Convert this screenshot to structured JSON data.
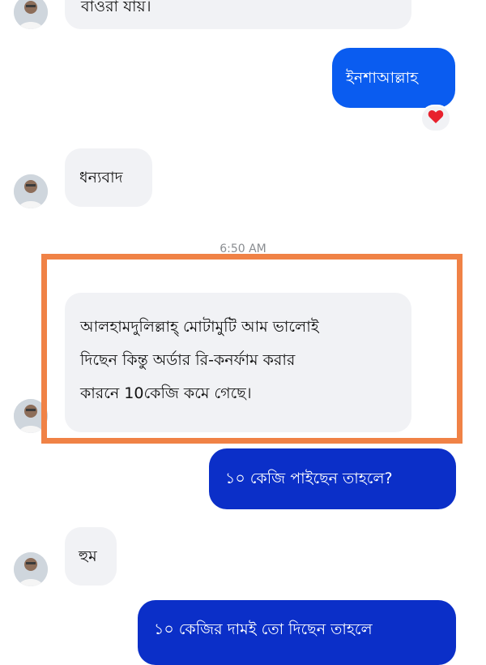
{
  "colors": {
    "outgoing_light": "#0a5cf0",
    "outgoing_dark": "#0b2fc8",
    "incoming_bg": "#f1f2f5",
    "highlight_border": "#f08246",
    "reaction_heart": "#e8212d"
  },
  "messages": [
    {
      "id": "m0",
      "side": "incoming",
      "text": "বাওরা যায়।",
      "cut_off": true
    },
    {
      "id": "m1",
      "side": "outgoing",
      "text": "ইনশাআল্লাহ",
      "reaction": "heart-icon"
    },
    {
      "id": "m2",
      "side": "incoming",
      "text": "ধন্যবাদ"
    },
    {
      "id": "m3",
      "side": "incoming",
      "lines": [
        "আলহামদুলিল্লাহ্ মোটামুটি আম ভালোই",
        "দিছেন কিন্তু অর্ডার রি-কনর্ফাম করার",
        "কারনে 10কেজি কমে গেছে।"
      ],
      "highlighted": true
    },
    {
      "id": "m4",
      "side": "outgoing",
      "text": "১০ কেজি পাইছেন তাহলে?"
    },
    {
      "id": "m5",
      "side": "incoming",
      "text": "হুম"
    },
    {
      "id": "m6",
      "side": "outgoing",
      "text": "১০ কেজির দামই তো দিছেন তাহলে"
    }
  ],
  "timestamp": "6:50 AM"
}
